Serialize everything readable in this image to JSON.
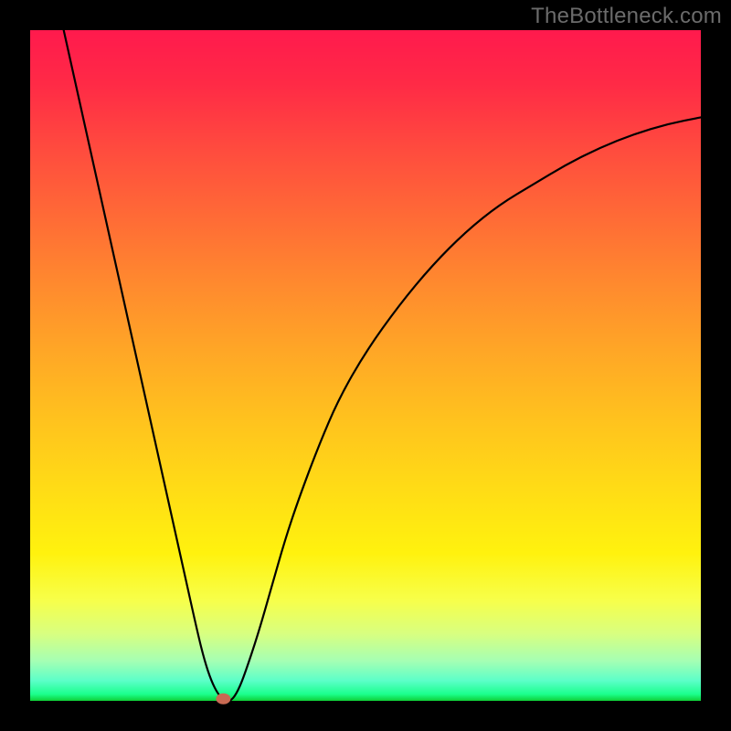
{
  "watermark": {
    "text": "TheBottleneck.com"
  },
  "chart_data": {
    "type": "line",
    "title": "",
    "xlabel": "",
    "ylabel": "",
    "xlim": [
      0,
      100
    ],
    "ylim": [
      0,
      100
    ],
    "grid": false,
    "legend": false,
    "series": [
      {
        "name": "bottleneck-curve",
        "color": "#000000",
        "x": [
          5,
          7,
          9,
          11,
          13,
          15,
          17,
          19,
          21,
          23,
          25,
          26,
          27,
          28,
          29,
          30,
          31,
          32,
          34,
          36,
          38,
          40,
          43,
          46,
          50,
          55,
          60,
          65,
          70,
          75,
          80,
          85,
          90,
          95,
          100
        ],
        "y": [
          100,
          91,
          82,
          73,
          64,
          55,
          46,
          37,
          28,
          19,
          10,
          6,
          3,
          1,
          0,
          0,
          1.5,
          4,
          10,
          17,
          24,
          30,
          38,
          45,
          52,
          59,
          65,
          70,
          74,
          77,
          80,
          82.5,
          84.5,
          86,
          87
        ]
      }
    ],
    "marker": {
      "x_pct": 0.288,
      "y_pct": 0.003,
      "color": "#c96a53"
    },
    "background_gradient": {
      "top": "#ff1a4d",
      "mid": "#ffc21e",
      "bottom": "#0fcf36"
    }
  }
}
